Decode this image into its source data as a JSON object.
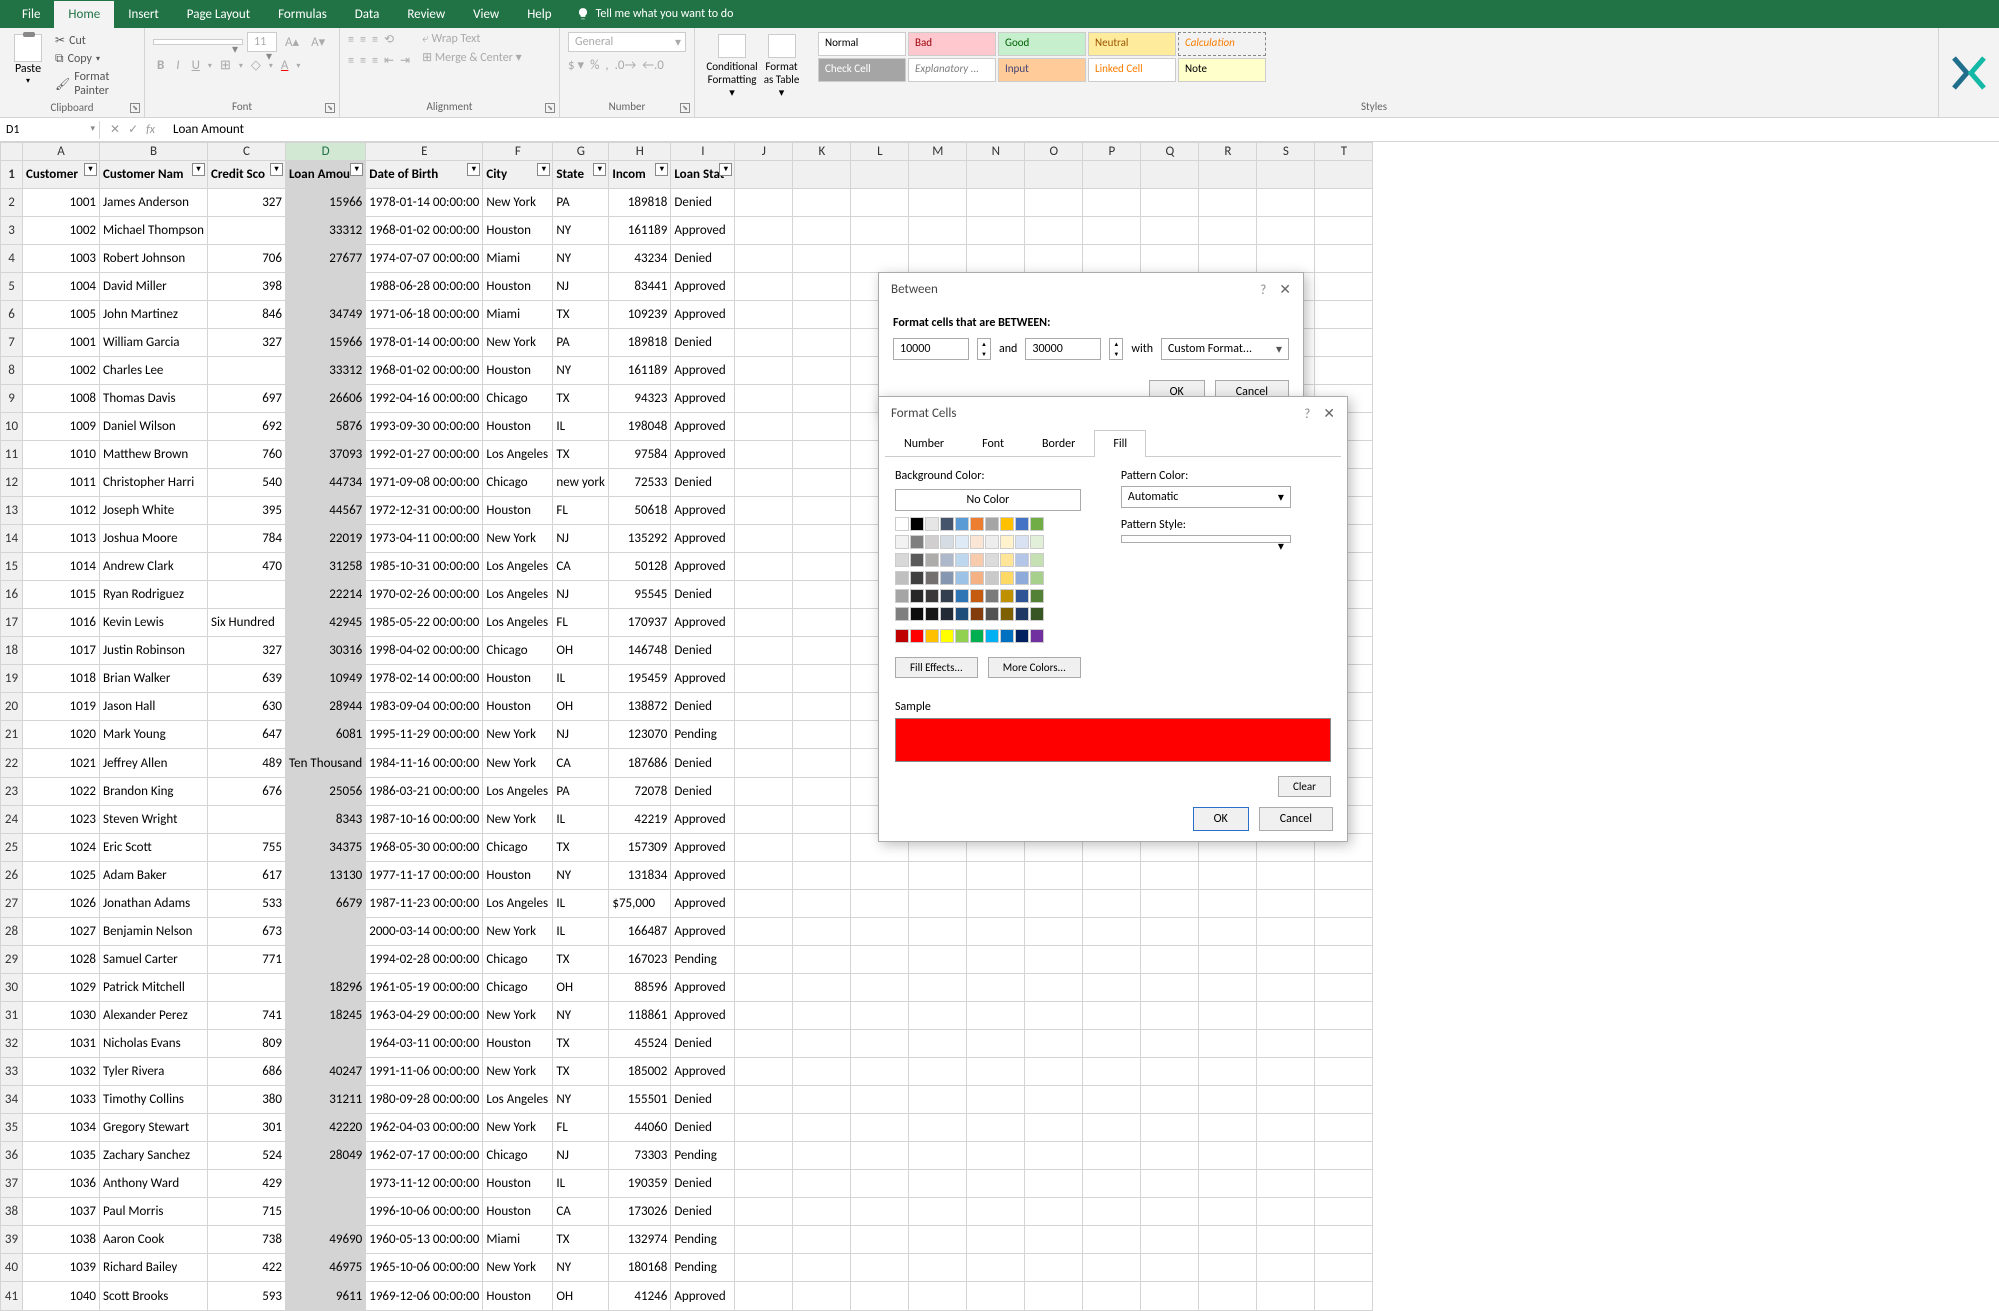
{
  "ribbon": {
    "tabs": [
      "File",
      "Home",
      "Insert",
      "Page Layout",
      "Formulas",
      "Data",
      "Review",
      "View",
      "Help"
    ],
    "active_tab": "Home",
    "tell_me": "Tell me what you want to do",
    "clipboard": {
      "paste": "Paste",
      "cut": "Cut",
      "copy": "Copy",
      "painter": "Format Painter",
      "label": "Clipboard"
    },
    "font": {
      "size": "11",
      "label": "Font"
    },
    "alignment": {
      "wrap": "Wrap Text",
      "merge": "Merge & Center",
      "label": "Alignment"
    },
    "number": {
      "format": "General",
      "label": "Number"
    },
    "cond": {
      "cf": "Conditional Formatting",
      "fat": "Format as Table"
    },
    "styles": {
      "items": [
        "Normal",
        "Bad",
        "Good",
        "Neutral",
        "Calculation",
        "Check Cell",
        "Explanatory ...",
        "Input",
        "Linked Cell",
        "Note"
      ],
      "label": "Styles"
    }
  },
  "name_box": "D1",
  "formula": "Loan Amount",
  "columns": [
    "A",
    "B",
    "C",
    "D",
    "E",
    "F",
    "G",
    "H",
    "I",
    "J",
    "K",
    "L",
    "M",
    "N",
    "O",
    "P",
    "Q",
    "R",
    "S",
    "T"
  ],
  "headers": [
    "Customer",
    "Customer Nam",
    "Credit Sco",
    "Loan Amou",
    "Date of Birth",
    "City",
    "State",
    "Incom",
    "Loan Stat"
  ],
  "rows": [
    {
      "n": 1001,
      "name": "James Anderson",
      "cs": "327",
      "la": "15966",
      "hl": 1,
      "dob": "1978-01-14 00:00:00",
      "city": "New York",
      "st": "PA",
      "inc": "189818",
      "ls": "Denied"
    },
    {
      "n": 1002,
      "name": "Michael Thompson",
      "cs": "",
      "la": "33312",
      "hl": 0,
      "dob": "1968-01-02 00:00:00",
      "city": "Houston",
      "st": "NY",
      "inc": "161189",
      "ls": "Approved"
    },
    {
      "n": 1003,
      "name": "Robert Johnson",
      "cs": "706",
      "la": "27677",
      "hl": 1,
      "dob": "1974-07-07 00:00:00",
      "city": "Miami",
      "st": "NY",
      "inc": "43234",
      "ls": "Denied"
    },
    {
      "n": 1004,
      "name": "David Miller",
      "cs": "398",
      "la": "",
      "hl": 0,
      "dob": "1988-06-28 00:00:00",
      "city": "Houston",
      "st": "NJ",
      "inc": "83441",
      "ls": "Approved"
    },
    {
      "n": 1005,
      "name": "John Martinez",
      "cs": "846",
      "la": "34749",
      "hl": 0,
      "dob": "1971-06-18 00:00:00",
      "city": "Miami",
      "st": "TX",
      "inc": "109239",
      "ls": "Approved"
    },
    {
      "n": 1001,
      "name": "William Garcia",
      "cs": "327",
      "la": "15966",
      "hl": 1,
      "dob": "1978-01-14 00:00:00",
      "city": "New York",
      "st": "PA",
      "inc": "189818",
      "ls": "Denied"
    },
    {
      "n": 1002,
      "name": "Charles Lee",
      "cs": "",
      "la": "33312",
      "hl": 0,
      "dob": "1968-01-02 00:00:00",
      "city": "Houston",
      "st": "NY",
      "inc": "161189",
      "ls": "Approved"
    },
    {
      "n": 1008,
      "name": "Thomas Davis",
      "cs": "697",
      "la": "26606",
      "hl": 1,
      "dob": "1992-04-16 00:00:00",
      "city": "Chicago",
      "st": "TX",
      "inc": "94323",
      "ls": "Approved"
    },
    {
      "n": 1009,
      "name": "Daniel Wilson",
      "cs": "692",
      "la": "5876",
      "hl": 0,
      "dob": "1993-09-30 00:00:00",
      "city": "Houston",
      "st": "IL",
      "inc": "198048",
      "ls": "Approved"
    },
    {
      "n": 1010,
      "name": "Matthew Brown",
      "cs": "760",
      "la": "37093",
      "hl": 0,
      "dob": "1992-01-27 00:00:00",
      "city": "Los Angeles",
      "st": "TX",
      "inc": "97584",
      "ls": "Approved"
    },
    {
      "n": 1011,
      "name": "Christopher Harri",
      "cs": "540",
      "la": "44734",
      "hl": 0,
      "dob": "1971-09-08 00:00:00",
      "city": "Chicago",
      "st": "new york",
      "inc": "72533",
      "ls": "Denied"
    },
    {
      "n": 1012,
      "name": "Joseph White",
      "cs": "395",
      "la": "44567",
      "hl": 0,
      "dob": "1972-12-31 00:00:00",
      "city": "Houston",
      "st": "FL",
      "inc": "50618",
      "ls": "Approved"
    },
    {
      "n": 1013,
      "name": "Joshua Moore",
      "cs": "784",
      "la": "22019",
      "hl": 1,
      "dob": "1973-04-11 00:00:00",
      "city": "New York",
      "st": "NJ",
      "inc": "135292",
      "ls": "Approved"
    },
    {
      "n": 1014,
      "name": "Andrew Clark",
      "cs": "470",
      "la": "31258",
      "hl": 0,
      "dob": "1985-10-31 00:00:00",
      "city": "Los Angeles",
      "st": "CA",
      "inc": "50128",
      "ls": "Approved"
    },
    {
      "n": 1015,
      "name": "Ryan Rodriguez",
      "cs": "",
      "la": "22214",
      "hl": 1,
      "dob": "1970-02-26 00:00:00",
      "city": "Los Angeles",
      "st": "NJ",
      "inc": "95545",
      "ls": "Denied"
    },
    {
      "n": 1016,
      "name": "Kevin Lewis",
      "cs": "Six Hundred",
      "la": "42945",
      "hl": 0,
      "dob": "1985-05-22 00:00:00",
      "city": "Los Angeles",
      "st": "FL",
      "inc": "170937",
      "ls": "Approved"
    },
    {
      "n": 1017,
      "name": "Justin Robinson",
      "cs": "327",
      "la": "30316",
      "hl": 0,
      "dob": "1998-04-02 00:00:00",
      "city": "Chicago",
      "st": "OH",
      "inc": "146748",
      "ls": "Denied"
    },
    {
      "n": 1018,
      "name": "Brian Walker",
      "cs": "639",
      "la": "10949",
      "hl": 1,
      "dob": "1978-02-14 00:00:00",
      "city": "Houston",
      "st": "IL",
      "inc": "195459",
      "ls": "Approved"
    },
    {
      "n": 1019,
      "name": "Jason Hall",
      "cs": "630",
      "la": "28944",
      "hl": 1,
      "dob": "1983-09-04 00:00:00",
      "city": "Houston",
      "st": "OH",
      "inc": "138872",
      "ls": "Denied"
    },
    {
      "n": 1020,
      "name": "Mark Young",
      "cs": "647",
      "la": "6081",
      "hl": 0,
      "dob": "1995-11-29 00:00:00",
      "city": "New York",
      "st": "NJ",
      "inc": "123070",
      "ls": "Pending"
    },
    {
      "n": 1021,
      "name": "Jeffrey Allen",
      "cs": "489",
      "la": "Ten Thousand",
      "hl": 0,
      "laText": true,
      "dob": "1984-11-16 00:00:00",
      "city": "New York",
      "st": "CA",
      "inc": "187686",
      "ls": "Denied"
    },
    {
      "n": 1022,
      "name": "Brandon King",
      "cs": "676",
      "la": "25056",
      "hl": 1,
      "dob": "1986-03-21 00:00:00",
      "city": "Los Angeles",
      "st": "PA",
      "inc": "72078",
      "ls": "Denied"
    },
    {
      "n": 1023,
      "name": "Steven Wright",
      "cs": "",
      "la": "8343",
      "hl": 0,
      "dob": "1987-10-16 00:00:00",
      "city": "New York",
      "st": "IL",
      "inc": "42219",
      "ls": "Approved"
    },
    {
      "n": 1024,
      "name": "Eric Scott",
      "cs": "755",
      "la": "34375",
      "hl": 0,
      "dob": "1968-05-30 00:00:00",
      "city": "Chicago",
      "st": "TX",
      "inc": "157309",
      "ls": "Approved"
    },
    {
      "n": 1025,
      "name": "Adam Baker",
      "cs": "617",
      "la": "13130",
      "hl": 1,
      "dob": "1977-11-17 00:00:00",
      "city": "Houston",
      "st": "NY",
      "inc": "131834",
      "ls": "Approved"
    },
    {
      "n": 1026,
      "name": "Jonathan Adams",
      "cs": "533",
      "la": "6679",
      "hl": 0,
      "dob": "1987-11-23 00:00:00",
      "city": "Los Angeles",
      "st": "IL",
      "inc": "$75,000",
      "incText": true,
      "ls": "Approved"
    },
    {
      "n": 1027,
      "name": "Benjamin Nelson",
      "cs": "673",
      "la": "",
      "hl": 0,
      "dob": "2000-03-14 00:00:00",
      "city": "New York",
      "st": "IL",
      "inc": "166487",
      "ls": "Approved"
    },
    {
      "n": 1028,
      "name": "Samuel Carter",
      "cs": "771",
      "la": "",
      "hl": 0,
      "dob": "1994-02-28 00:00:00",
      "city": "Chicago",
      "st": "TX",
      "inc": "167023",
      "ls": "Pending"
    },
    {
      "n": 1029,
      "name": "Patrick Mitchell",
      "cs": "",
      "la": "18296",
      "hl": 1,
      "dob": "1961-05-19 00:00:00",
      "city": "Chicago",
      "st": "OH",
      "inc": "88596",
      "ls": "Approved"
    },
    {
      "n": 1030,
      "name": "Alexander Perez",
      "cs": "741",
      "la": "18245",
      "hl": 1,
      "dob": "1963-04-29 00:00:00",
      "city": "New York",
      "st": "NY",
      "inc": "118861",
      "ls": "Approved"
    },
    {
      "n": 1031,
      "name": "Nicholas Evans",
      "cs": "809",
      "la": "",
      "hl": 0,
      "dob": "1964-03-11 00:00:00",
      "city": "Houston",
      "st": "TX",
      "inc": "45524",
      "ls": "Denied"
    },
    {
      "n": 1032,
      "name": "Tyler Rivera",
      "cs": "686",
      "la": "40247",
      "hl": 0,
      "dob": "1991-11-06 00:00:00",
      "city": "New York",
      "st": "TX",
      "inc": "185002",
      "ls": "Approved"
    },
    {
      "n": 1033,
      "name": "Timothy Collins",
      "cs": "380",
      "la": "31211",
      "hl": 0,
      "dob": "1980-09-28 00:00:00",
      "city": "Los Angeles",
      "st": "NY",
      "inc": "155501",
      "ls": "Denied"
    },
    {
      "n": 1034,
      "name": "Gregory Stewart",
      "cs": "301",
      "la": "42220",
      "hl": 0,
      "dob": "1962-04-03 00:00:00",
      "city": "New York",
      "st": "FL",
      "inc": "44060",
      "ls": "Denied"
    },
    {
      "n": 1035,
      "name": "Zachary Sanchez",
      "cs": "524",
      "la": "28049",
      "hl": 1,
      "dob": "1962-07-17 00:00:00",
      "city": "Chicago",
      "st": "NJ",
      "inc": "73303",
      "ls": "Pending"
    },
    {
      "n": 1036,
      "name": "Anthony Ward",
      "cs": "429",
      "la": "",
      "hl": 0,
      "dob": "1973-11-12 00:00:00",
      "city": "Houston",
      "st": "IL",
      "inc": "190359",
      "ls": "Denied"
    },
    {
      "n": 1037,
      "name": "Paul Morris",
      "cs": "715",
      "la": "",
      "hl": 0,
      "dob": "1996-10-06 00:00:00",
      "city": "Houston",
      "st": "CA",
      "inc": "173026",
      "ls": "Denied"
    },
    {
      "n": 1038,
      "name": "Aaron Cook",
      "cs": "738",
      "la": "49690",
      "hl": 0,
      "dob": "1960-05-13 00:00:00",
      "city": "Miami",
      "st": "TX",
      "inc": "132974",
      "ls": "Pending"
    },
    {
      "n": 1039,
      "name": "Richard Bailey",
      "cs": "422",
      "la": "46975",
      "hl": 0,
      "dob": "1965-10-06 00:00:00",
      "city": "New York",
      "st": "NY",
      "inc": "180168",
      "ls": "Pending"
    },
    {
      "n": 1040,
      "name": "Scott Brooks",
      "cs": "593",
      "la": "9611",
      "hl": 0,
      "dob": "1969-12-06 00:00:00",
      "city": "Houston",
      "st": "OH",
      "inc": "41246",
      "ls": "Approved"
    }
  ],
  "between_dialog": {
    "title": "Between",
    "label": "Format cells that are BETWEEN:",
    "val1": "10000",
    "and": "and",
    "val2": "30000",
    "with": "with",
    "format": "Custom Format...",
    "ok": "OK",
    "cancel": "Cancel"
  },
  "format_dialog": {
    "title": "Format Cells",
    "tabs": [
      "Number",
      "Font",
      "Border",
      "Fill"
    ],
    "active_tab": "Fill",
    "bg_label": "Background Color:",
    "nocolor": "No Color",
    "fill_effects": "Fill Effects...",
    "more_colors": "More Colors...",
    "pattern_color": "Pattern Color:",
    "automatic": "Automatic",
    "pattern_style": "Pattern Style:",
    "sample": "Sample",
    "clear": "Clear",
    "ok": "OK",
    "cancel": "Cancel",
    "theme_row1": [
      "#ffffff",
      "#000000",
      "#e7e6e6",
      "#44546a",
      "#5b9bd5",
      "#ed7d31",
      "#a5a5a5",
      "#ffc000",
      "#4472c4",
      "#70ad47"
    ],
    "theme_shades": [
      [
        "#f2f2f2",
        "#7f7f7f",
        "#d0cece",
        "#d6dce4",
        "#deebf6",
        "#fbe5d5",
        "#ededed",
        "#fff2cc",
        "#d9e2f3",
        "#e2efd9"
      ],
      [
        "#d8d8d8",
        "#595959",
        "#aeabab",
        "#adb9ca",
        "#bdd7ee",
        "#f7cbac",
        "#dbdbdb",
        "#fee599",
        "#b4c6e7",
        "#c5e0b3"
      ],
      [
        "#bfbfbf",
        "#3f3f3f",
        "#757070",
        "#8496b0",
        "#9cc3e5",
        "#f4b183",
        "#c9c9c9",
        "#ffd965",
        "#8eaadb",
        "#a8d08d"
      ],
      [
        "#a5a5a5",
        "#262626",
        "#3a3838",
        "#323f4f",
        "#2e75b5",
        "#c55a11",
        "#7b7b7b",
        "#bf9000",
        "#2f5496",
        "#538135"
      ],
      [
        "#7f7f7f",
        "#0c0c0c",
        "#171616",
        "#222a35",
        "#1e4e79",
        "#833c0b",
        "#525252",
        "#7f6000",
        "#1f3864",
        "#375623"
      ]
    ],
    "standard": [
      "#c00000",
      "#ff0000",
      "#ffc000",
      "#ffff00",
      "#92d050",
      "#00b050",
      "#00b0f0",
      "#0070c0",
      "#002060",
      "#7030a0"
    ]
  }
}
